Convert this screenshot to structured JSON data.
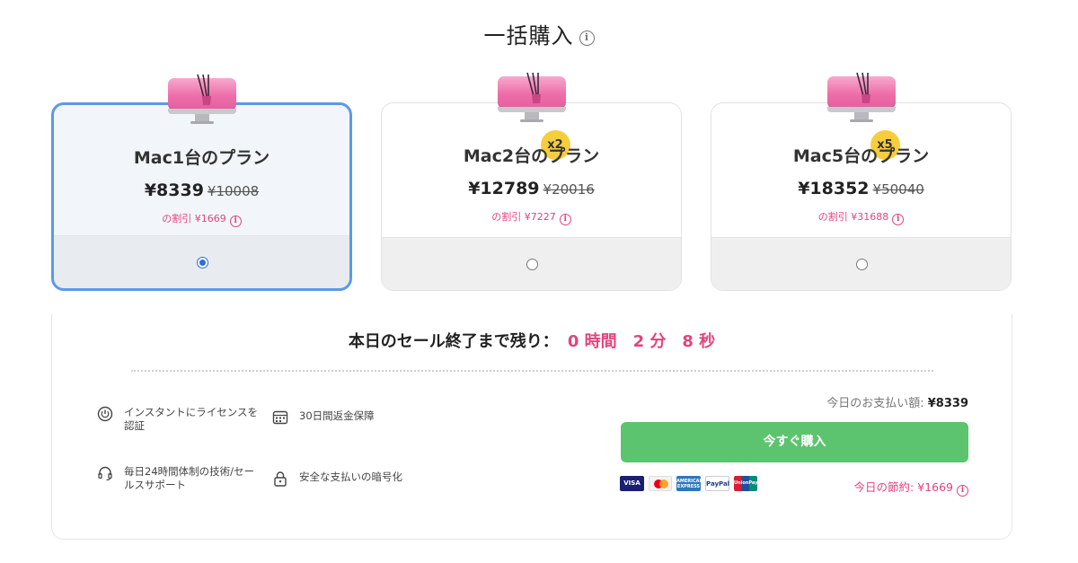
{
  "header": {
    "title": "一括購入"
  },
  "plans": [
    {
      "name": "Mac1台のプラン",
      "price": "¥8339",
      "old_price": "¥10008",
      "discount": "の割引 ¥1669",
      "badge": "",
      "selected": true
    },
    {
      "name": "Mac2台のプラン",
      "price": "¥12789",
      "old_price": "¥20016",
      "discount": "の割引 ¥7227",
      "badge": "x2",
      "selected": false
    },
    {
      "name": "Mac5台のプラン",
      "price": "¥18352",
      "old_price": "¥50040",
      "discount": "の割引 ¥31688",
      "badge": "x5",
      "selected": false
    }
  ],
  "timer": {
    "label": "本日のセール終了まで残り：",
    "value": "0 時間　2 分　8 秒"
  },
  "features": [
    {
      "icon": "power-icon",
      "text": "インスタントにライセンスを\n認証"
    },
    {
      "icon": "calendar-icon",
      "text": "30日間返金保障"
    },
    {
      "icon": "headset-icon",
      "text": "毎日24時間体制の技術/セー\nルスサポート"
    },
    {
      "icon": "lock-icon",
      "text": "安全な支払いの暗号化"
    }
  ],
  "payment": {
    "today_label": "今日のお支払い額: ",
    "today_amount": "¥8339",
    "buy_label": "今すぐ購入",
    "savings": "今日の節約: ¥1669",
    "cards": [
      "VISA",
      "Mastercard",
      "AMERICAN EXPRESS",
      "PayPal",
      "UnionPay"
    ]
  },
  "colors": {
    "accent_pink": "#e0457b",
    "buy_green": "#5cc36f",
    "selected_border": "#5b9ae6",
    "badge_yellow": "#f6cd3d"
  }
}
